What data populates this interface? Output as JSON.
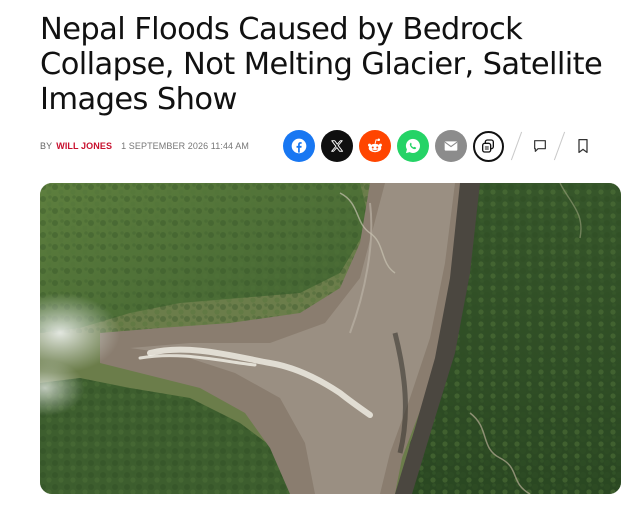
{
  "article": {
    "headline": "Nepal Floods Caused by Bedrock Collapse, Not Melting Glacier, Satellite Images Show",
    "by_label": "BY",
    "author": "WILL JONES",
    "date": "1 SEPTEMBER 2026 11:44 AM"
  },
  "share_buttons": [
    {
      "icon": "facebook-icon",
      "color": "#1877f2"
    },
    {
      "icon": "x-icon",
      "color": "#0f0f0f"
    },
    {
      "icon": "reddit-icon",
      "color": "#ff4500"
    },
    {
      "icon": "whatsapp-icon",
      "color": "#25d366"
    },
    {
      "icon": "email-icon",
      "color": "#8c8c8c"
    },
    {
      "icon": "copy-link-icon",
      "color": "#ffffff"
    }
  ],
  "actions": [
    {
      "icon": "comment-icon"
    },
    {
      "icon": "bookmark-icon"
    }
  ],
  "hero_image": {
    "description_icon": "satellite-image"
  },
  "colors": {
    "author": "#c8102e",
    "text": "#111111",
    "meta": "#777777"
  }
}
